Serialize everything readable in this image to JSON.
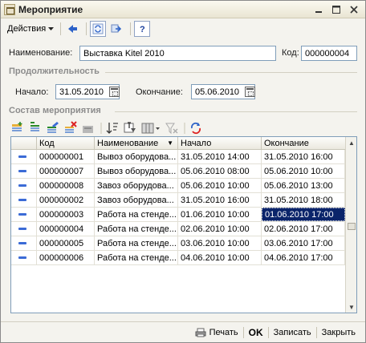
{
  "window": {
    "title": "Мероприятие",
    "controls": [
      "minimize-icon",
      "maximize-icon",
      "close-icon"
    ]
  },
  "toolbar": {
    "actions_label": "Действия",
    "icons": [
      "back-arrow-icon",
      "refresh-icon",
      "next-arrow-icon",
      "help-icon"
    ]
  },
  "form": {
    "name_label": "Наименование:",
    "name_value": "Выставка Kitel 2010",
    "code_label": "Код:",
    "code_value": "000000004",
    "duration_section": "Продолжительность",
    "start_label": "Начало:",
    "start_value": "31.05.2010",
    "end_label": "Окончание:",
    "end_value": "05.06.2010",
    "composition_section": "Состав мероприятия"
  },
  "table": {
    "toolbar_icons": [
      "add-row-icon",
      "add-copy-icon",
      "edit-row-icon",
      "delete-row-icon",
      "end-edit-icon",
      "sort-asc-icon",
      "sort-filter-icon",
      "columns-dropdown-icon",
      "clear-filter-icon",
      "refresh-table-icon"
    ],
    "columns": [
      "",
      "Код",
      "Наименование",
      "Начало",
      "Окончание"
    ],
    "sort_indicator": "▼",
    "rows": [
      {
        "code": "000000001",
        "name": "Вывоз оборудова...",
        "start": "31.05.2010 14:00",
        "end": "31.05.2010 16:00"
      },
      {
        "code": "000000007",
        "name": "Вывоз оборудова...",
        "start": "05.06.2010 08:00",
        "end": "05.06.2010 10:00"
      },
      {
        "code": "000000008",
        "name": "Завоз оборудова...",
        "start": "05.06.2010 10:00",
        "end": "05.06.2010 13:00"
      },
      {
        "code": "000000002",
        "name": "Завоз оборудова...",
        "start": "31.05.2010 16:00",
        "end": "31.05.2010 18:00"
      },
      {
        "code": "000000003",
        "name": "Работа на стенде...",
        "start": "01.06.2010 10:00",
        "end": "01.06.2010 17:00"
      },
      {
        "code": "000000004",
        "name": "Работа на стенде...",
        "start": "02.06.2010 10:00",
        "end": "02.06.2010 17:00"
      },
      {
        "code": "000000005",
        "name": "Работа на стенде...",
        "start": "03.06.2010 10:00",
        "end": "03.06.2010 17:00"
      },
      {
        "code": "000000006",
        "name": "Работа на стенде...",
        "start": "04.06.2010 10:00",
        "end": "04.06.2010 17:00"
      }
    ],
    "selected_row": 4
  },
  "bottom": {
    "print_label": "Печать",
    "ok_label": "OK",
    "save_label": "Записать",
    "close_label": "Закрыть"
  }
}
